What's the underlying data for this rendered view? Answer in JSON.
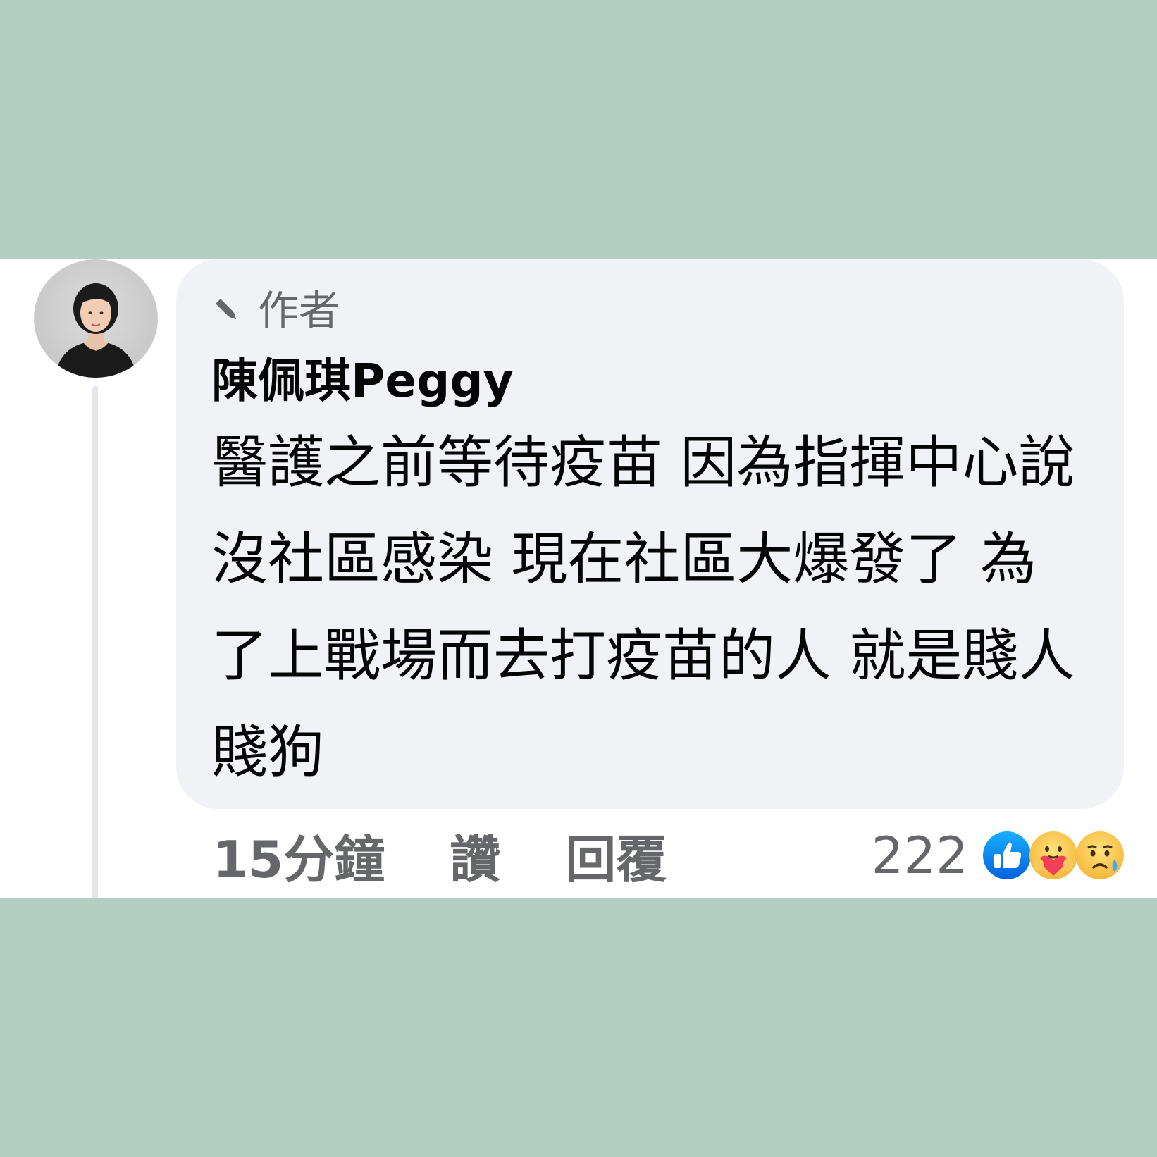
{
  "comment": {
    "author_badge": "作者",
    "author_name": "陳佩琪Peggy",
    "text": "醫護之前等待疫苗 因為指揮中心說沒社區感染 現在社區大爆發了 為了上戰場而去打疫苗的人 就是賤人 賤狗",
    "timestamp": "15分鐘",
    "like_label": "讚",
    "reply_label": "回覆",
    "reaction_count": "222",
    "reactions": [
      "like-icon",
      "care-icon",
      "sad-icon"
    ]
  },
  "colors": {
    "background_band": "#b3cfc4",
    "bubble": "#f0f2f5",
    "like_blue": "#1877f2",
    "muted_text": "#65676b"
  }
}
